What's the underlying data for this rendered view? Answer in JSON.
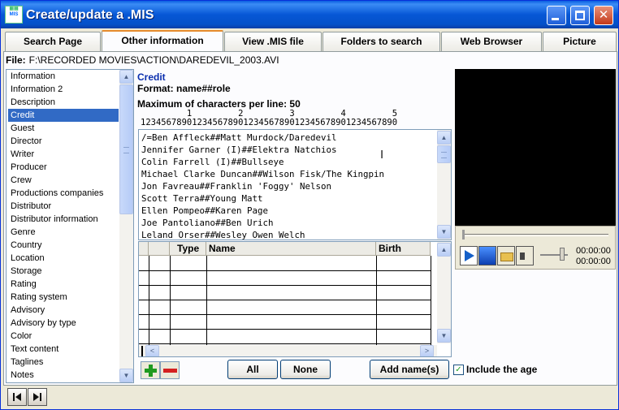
{
  "window": {
    "title": "Create/update a .MIS",
    "icon_text": "MIS"
  },
  "tabs": [
    {
      "label": "Search Page",
      "active": false
    },
    {
      "label": "Other information",
      "active": true
    },
    {
      "label": "View .MIS file",
      "active": false
    },
    {
      "label": "Folders to search",
      "active": false
    },
    {
      "label": "Web Browser",
      "active": false
    },
    {
      "label": "Picture",
      "active": false
    }
  ],
  "file": {
    "label": "File:",
    "path": "F:\\RECORDED MOVIES\\ACTION\\DAREDEVIL_2003.AVI"
  },
  "fields_list": {
    "items": [
      "Information",
      "Information 2",
      "Description",
      "Credit",
      "Guest",
      "Director",
      "Writer",
      "Producer",
      "Crew",
      "Productions companies",
      "Distributor",
      "Distributor information",
      "Genre",
      "Country",
      "Location",
      "Storage",
      "Rating",
      "Rating system",
      "Advisory",
      "Advisory by type",
      "Color",
      "Text content",
      "Taglines",
      "Notes"
    ],
    "selected": "Credit"
  },
  "editor": {
    "field_name": "Credit",
    "format": "Format: name##role",
    "max_chars": "Maximum of characters per line: 50",
    "ruler_tens": "         1         2         3         4         5",
    "ruler_units": "12345678901234567890123456789012345678901234567890",
    "lines": [
      "/=Ben Affleck##Matt Murdock/Daredevil",
      "Jennifer Garner (I)##Elektra Natchios",
      "Colin Farrell (I)##Bullseye",
      "Michael Clarke Duncan##Wilson Fisk/The Kingpin",
      "Jon Favreau##Franklin 'Foggy' Nelson",
      "Scott Terra##Young Matt",
      "Ellen Pompeo##Karen Page",
      "Joe Pantoliano##Ben Urich",
      "Leland Orser##Wesley Owen Welch"
    ]
  },
  "grid": {
    "columns": [
      "",
      "",
      "Type",
      "Name",
      "Birth"
    ]
  },
  "buttons": {
    "all": "All",
    "none": "None",
    "add_names": "Add name(s)"
  },
  "include_age": {
    "label": "Include the age",
    "checked": true,
    "check_glyph": "✓"
  },
  "player": {
    "time_elapsed": "00:00:00",
    "time_total": "00:00:00"
  },
  "icons": {
    "scroll_up": "▲",
    "scroll_down": "▼",
    "scroll_left": "<",
    "scroll_right": ">",
    "close": "✕",
    "ibeam": "I"
  },
  "colors": {
    "titlebar": "#0757d6",
    "selection": "#316ac5",
    "tab_highlight": "#e68b2c",
    "credit_title": "#0b2fae"
  }
}
